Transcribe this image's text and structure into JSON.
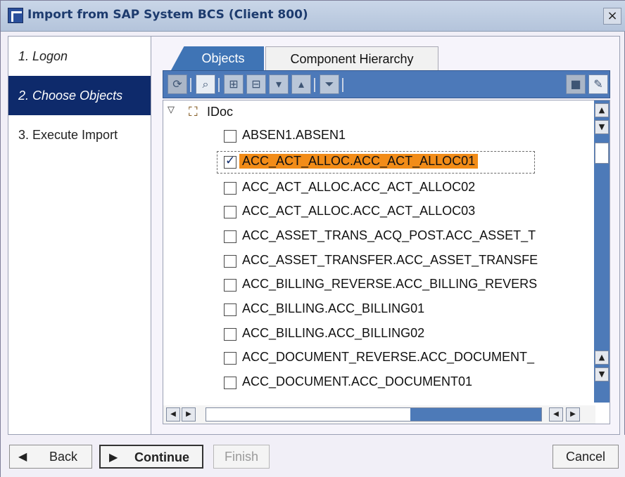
{
  "window": {
    "title": "Import from SAP System BCS (Client 800)",
    "close": "×"
  },
  "steps": [
    {
      "label": "1. Logon"
    },
    {
      "label": "2. Choose Objects"
    },
    {
      "label": "3. Execute Import"
    }
  ],
  "tabs": [
    {
      "label": "Objects"
    },
    {
      "label": "Component Hierarchy"
    }
  ],
  "toolbar": {
    "icons": [
      "refresh-icon",
      "find-icon",
      "expand-all-icon",
      "collapse-all-icon",
      "move-down-icon",
      "move-up-icon",
      "filter-icon",
      "stop-icon",
      "select-icon"
    ]
  },
  "tree": {
    "root": "IDoc",
    "items": [
      {
        "label": "ABSEN1.ABSEN1",
        "checked": false
      },
      {
        "label": "ACC_ACT_ALLOC.ACC_ACT_ALLOC01",
        "checked": true
      },
      {
        "label": "ACC_ACT_ALLOC.ACC_ACT_ALLOC02",
        "checked": false
      },
      {
        "label": "ACC_ACT_ALLOC.ACC_ACT_ALLOC03",
        "checked": false
      },
      {
        "label": "ACC_ASSET_TRANS_ACQ_POST.ACC_ASSET_T",
        "checked": false
      },
      {
        "label": "ACC_ASSET_TRANSFER.ACC_ASSET_TRANSFE",
        "checked": false
      },
      {
        "label": "ACC_BILLING_REVERSE.ACC_BILLING_REVERS",
        "checked": false
      },
      {
        "label": "ACC_BILLING.ACC_BILLING01",
        "checked": false
      },
      {
        "label": "ACC_BILLING.ACC_BILLING02",
        "checked": false
      },
      {
        "label": "ACC_DOCUMENT_REVERSE.ACC_DOCUMENT_",
        "checked": false
      },
      {
        "label": "ACC_DOCUMENT.ACC_DOCUMENT01",
        "checked": false
      }
    ]
  },
  "buttons": {
    "back": "Back",
    "continue": "Continue",
    "finish": "Finish",
    "cancel": "Cancel"
  }
}
